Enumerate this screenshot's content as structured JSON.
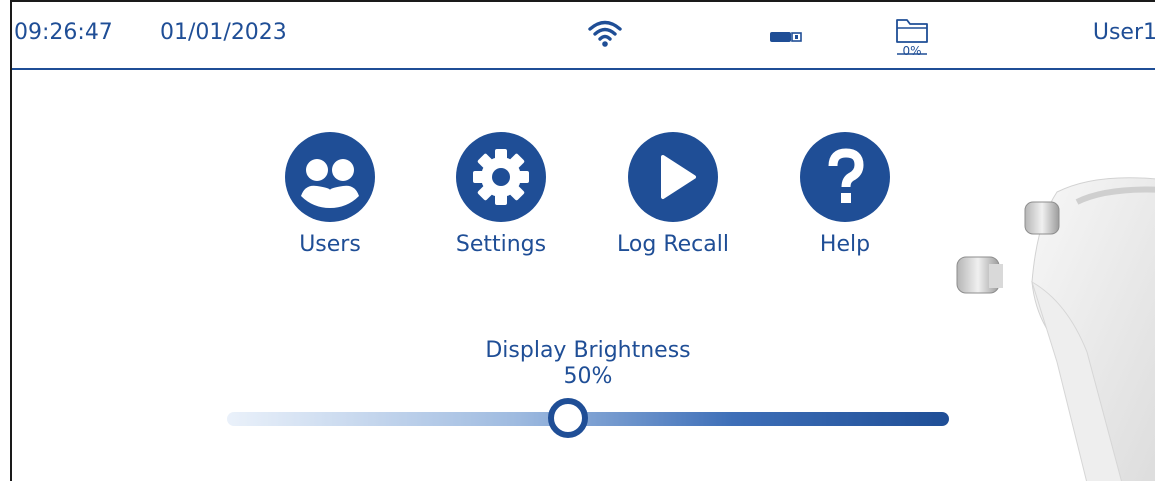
{
  "status_bar": {
    "time": "09:26:47",
    "date": "01/01/2023",
    "wifi_icon": "wifi-icon",
    "usb_icon": "usb-icon",
    "storage_icon": "folder-icon",
    "storage_percent": "0%",
    "user": "User1"
  },
  "menu": {
    "items": [
      {
        "label": "Users",
        "icon": "users-icon"
      },
      {
        "label": "Settings",
        "icon": "gear-icon"
      },
      {
        "label": "Log Recall",
        "icon": "play-icon"
      },
      {
        "label": "Help",
        "icon": "question-icon"
      }
    ]
  },
  "brightness": {
    "title": "Display Brightness",
    "value_label": "50%",
    "value": 0.5
  },
  "colors": {
    "accent": "#1f4e96",
    "background": "#ffffff"
  }
}
